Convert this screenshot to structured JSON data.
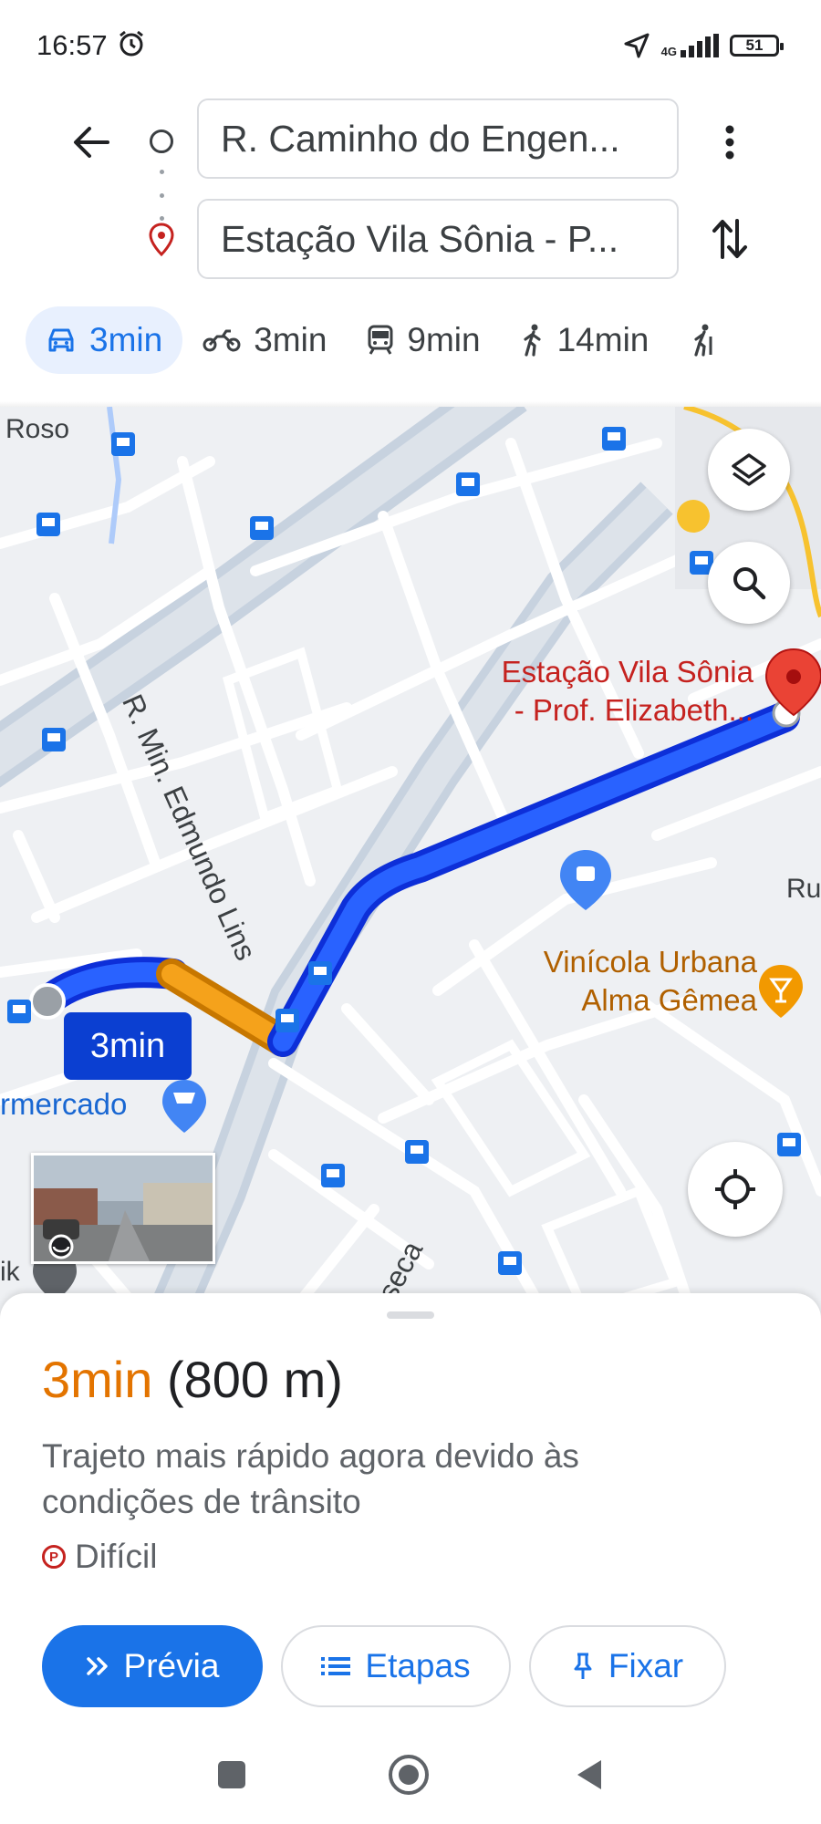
{
  "status_bar": {
    "time": "16:57",
    "network": "4G",
    "battery": "51",
    "icons": [
      "alarm-icon",
      "location-arrow-icon",
      "signal-icon",
      "battery-icon"
    ]
  },
  "directions": {
    "origin": "R. Caminho do Engen...",
    "destination": "Estação Vila Sônia - P...",
    "icons": [
      "back-arrow-icon",
      "origin-circle-icon",
      "destination-pin-icon",
      "more-vert-icon",
      "swap-icon"
    ]
  },
  "modes": [
    {
      "icon": "car-icon",
      "label": "3min",
      "active": true
    },
    {
      "icon": "motorcycle-icon",
      "label": "3min",
      "active": false
    },
    {
      "icon": "transit-icon",
      "label": "9min",
      "active": false
    },
    {
      "icon": "walk-icon",
      "label": "14min",
      "active": false
    }
  ],
  "map": {
    "labels": {
      "roso": "Roso",
      "street_edmundo": "R. Min. Edmundo Lins",
      "dest_line1": "Estação Vila Sônia",
      "dest_line2": "- Prof. Elizabeth...",
      "shop_line1": "Vinícola Urbana",
      "shop_line2": "Alma Gêmea",
      "mercado": "rmercado",
      "fonseca": "onseca",
      "ru": "Ru",
      "ik": "ik"
    },
    "route_badge": "3min",
    "route_colors": {
      "fast": "#1a3fe8",
      "slow": "#f29c12"
    },
    "buttons": [
      "layers-icon",
      "search-icon",
      "my-location-icon"
    ]
  },
  "summary": {
    "time": "3min",
    "distance": "(800 m)",
    "description": "Trajeto mais rápido agora devido às condições de trânsito",
    "parking": "Difícil",
    "parking_icon_letter": "P"
  },
  "actions": {
    "preview": "Prévia",
    "steps": "Etapas",
    "pin": "Fixar"
  },
  "colors": {
    "accent": "#1a73e8",
    "route_time": "#e37400",
    "destination": "#c5221f"
  }
}
